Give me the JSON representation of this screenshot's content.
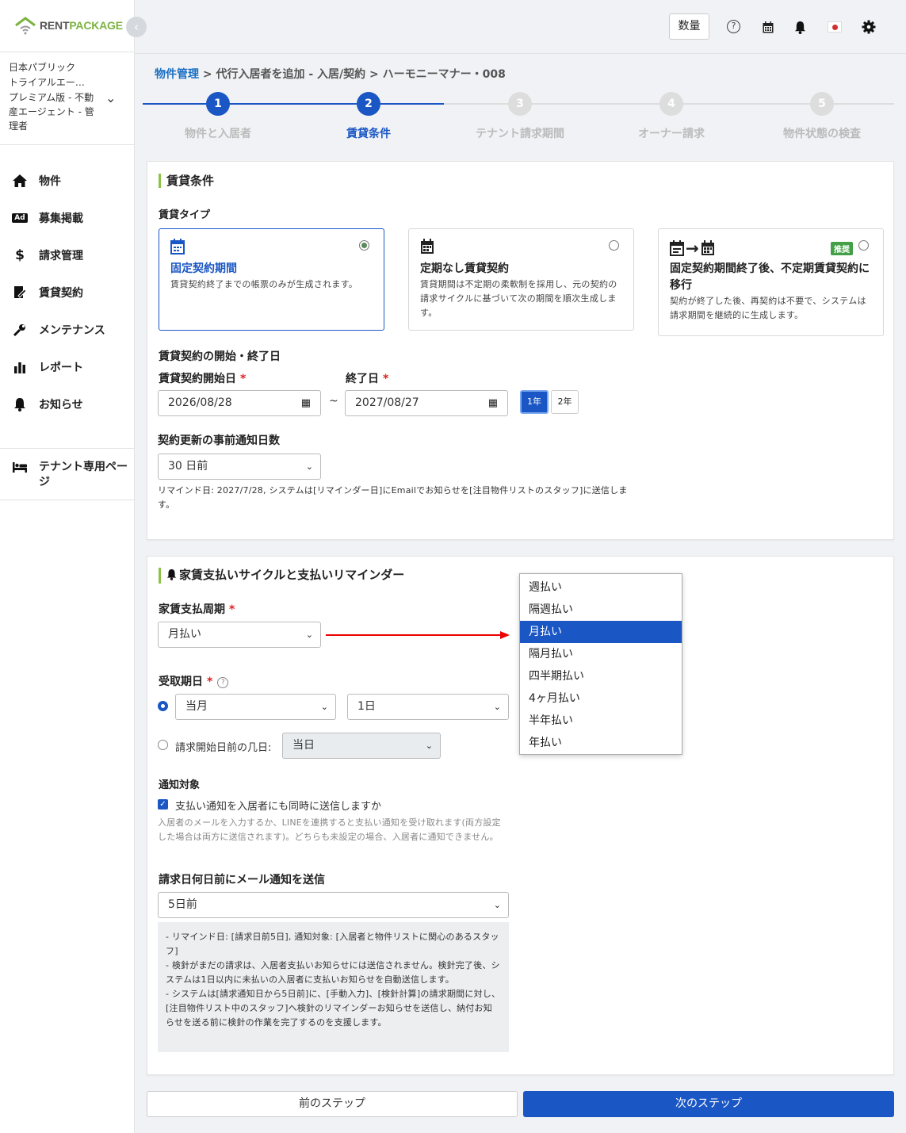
{
  "app": {
    "logo_rent": "RENT",
    "logo_package": "PACKAGE"
  },
  "sidebar": {
    "org_name_1": "日本パブリック",
    "org_name_2": "トライアルエー…",
    "org_plan": "プレミアム版 - 不動産エージェント - 管理者",
    "items": [
      {
        "label": "物件",
        "icon": "home-icon"
      },
      {
        "label": "募集掲載",
        "icon": "ad-icon"
      },
      {
        "label": "請求管理",
        "icon": "dollar-icon"
      },
      {
        "label": "賃貸契約",
        "icon": "contract-icon"
      },
      {
        "label": "メンテナンス",
        "icon": "wrench-icon"
      },
      {
        "label": "レポート",
        "icon": "chart-icon"
      },
      {
        "label": "お知らせ",
        "icon": "bell-icon"
      }
    ],
    "tenant_page": "テナント専用ページ"
  },
  "topbar": {
    "qty_label": "数量"
  },
  "breadcrumb": {
    "link": "物件管理",
    "rest": " > 代行入居者を追加 - 入居/契約 > ハーモニーマナー・008"
  },
  "steps": [
    {
      "num": "1",
      "label": "物件と入居者"
    },
    {
      "num": "2",
      "label": "賃貸条件"
    },
    {
      "num": "3",
      "label": "テナント請求期間"
    },
    {
      "num": "4",
      "label": "オーナー請求"
    },
    {
      "num": "5",
      "label": "物件状態の検査"
    }
  ],
  "lease": {
    "section_title": "賃貸条件",
    "type_label": "賃貸タイプ",
    "types": [
      {
        "title": "固定契約期間",
        "desc": "賃貸契約終了までの帳票のみが生成されます。"
      },
      {
        "title": "定期なし賃貸契約",
        "desc": "賃貸期間は不定期の柔軟制を採用し、元の契約の請求サイクルに基づいて次の期間を順次生成します。"
      },
      {
        "title": "固定契約期間終了後、不定期賃貸契約に移行",
        "desc": "契約が終了した後、再契約は不要で、システムは請求期間を継続的に生成します。",
        "badge": "推奨"
      }
    ],
    "period_label": "賃貸契約の開始・終了日",
    "start_label": "賃貸契約開始日",
    "end_label": "終了日",
    "required_mark": "*",
    "start_value": "2026/08/28",
    "end_value": "2027/08/27",
    "tilde": "~",
    "year_1": "1年",
    "year_2": "2年",
    "notice_label": "契約更新の事前通知日数",
    "notice_value": "30 日前",
    "notice_note": "リマインド日: 2027/7/28, システムは[リマインダー日]にEmailでお知らせを[注目物件リストのスタッフ]に送信します。"
  },
  "payment": {
    "section_title": "家賃支払いサイクルと支払いリマインダー",
    "cycle_label": "家賃支払周期",
    "cycle_value": "月払い",
    "due_label": "受取期日",
    "due_month": "当月",
    "due_day": "1日",
    "before_label": "請求開始日前の几日:",
    "before_value": "当日",
    "notify_label": "通知対象",
    "notify_check": "支払い通知を入居者にも同時に送信しますか",
    "notify_note": "入居者のメールを入力するか、LINEを連携すると支払い通知を受け取れます(両方設定した場合は両方に送信されます)。どちらも未設定の場合、入居者に通知できません。",
    "email_label": "請求日何日前にメール通知を送信",
    "email_value": "5日前",
    "info_1": "- リマインド日: [請求日前5日],  通知対象: [入居者と物件リストに関心のあるスタッフ]",
    "info_2": "- 検針がまだの請求は、入居者支払いお知らせには送信されません。検針完了後、システムは1日以内に未払いの入居者に支払いお知らせを自動送信します。",
    "info_3": "- システムは[請求通知日から5日前]に、[手動入力]、[検針計算]の請求期間に対し、[注目物件リスト中のスタッフ]へ検針のリマインダーお知らせを送信し、納付お知らせを送る前に検針の作業を完了するのを支援します。"
  },
  "dropdown": {
    "options": [
      "週払い",
      "隔週払い",
      "月払い",
      "隔月払い",
      "四半期払い",
      "4ヶ月払い",
      "半年払い",
      "年払い"
    ],
    "selected": "月払い"
  },
  "footer": {
    "prev": "前のステップ",
    "next": "次のステップ"
  },
  "colors": {
    "primary": "#1a56c4",
    "accent_green": "#8bc34a",
    "badge_green": "#43a047",
    "arrow_red": "#e00000"
  }
}
